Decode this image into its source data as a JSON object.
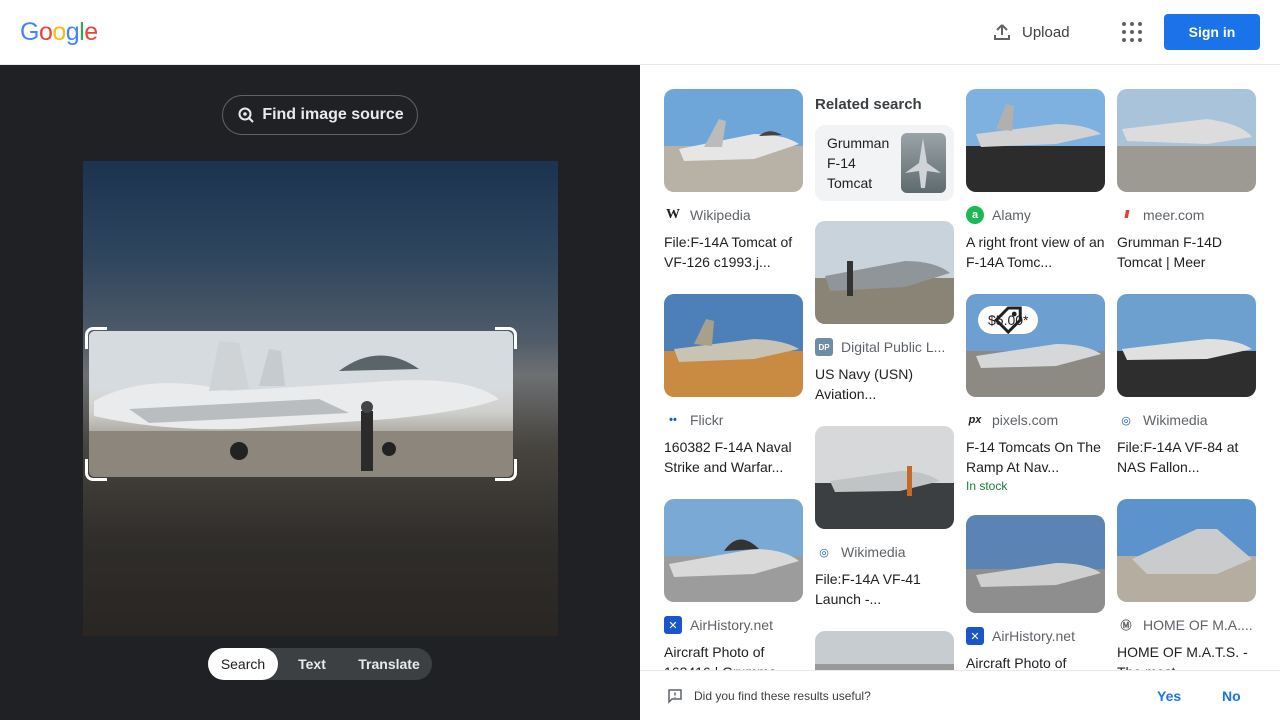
{
  "header": {
    "logo": [
      "G",
      "o",
      "o",
      "g",
      "l",
      "e"
    ],
    "logo_colors": [
      "#4285f4",
      "#ea4335",
      "#fbbc05",
      "#4285f4",
      "#34a853",
      "#ea4335"
    ],
    "upload_label": "Upload",
    "apps_icon": "apps-grid-icon",
    "signin_label": "Sign in"
  },
  "lens": {
    "find_source_label": "Find image source",
    "modes": [
      "Search",
      "Text",
      "Translate"
    ],
    "active_mode": "Search"
  },
  "results": {
    "related_heading": "Related search",
    "related_query": "Grumman F-14 Tomcat",
    "col1": [
      {
        "source": "Wikipedia",
        "favicon": "W",
        "favicon_color": "#fff",
        "favicon_text": "#202124",
        "title": "File:F-14A Tomcat of VF-126 c1993.j..."
      },
      {
        "source": "Flickr",
        "favicon": "••",
        "favicon_color": "#fff",
        "favicon_text": "#0063dc",
        "title": "160382 F-14A Naval Strike and Warfar..."
      },
      {
        "source": "AirHistory.net",
        "favicon": "✕",
        "favicon_color": "#1a56c8",
        "favicon_text": "#fff",
        "title": "Aircraft Photo of 163416 | Grumma..."
      }
    ],
    "col2": [
      {
        "source": "Digital Public L...",
        "favicon": "DP",
        "favicon_color": "#6e8ca6",
        "favicon_text": "#fff",
        "title": "US Navy (USN) Aviation..."
      },
      {
        "source": "Wikimedia",
        "favicon": "◎",
        "favicon_color": "#fff",
        "favicon_text": "#1a56c8",
        "title": "File:F-14A VF-41 Launch -..."
      }
    ],
    "col3": [
      {
        "source": "Alamy",
        "favicon": "a",
        "favicon_color": "#1db954",
        "favicon_text": "#fff",
        "title": "A right front view of an F-14A Tomc..."
      },
      {
        "source": "pixels.com",
        "favicon": "px",
        "favicon_color": "#fff",
        "favicon_text": "#202124",
        "title": "F-14 Tomcats On The Ramp At Nav...",
        "price": "$5.00*",
        "stock": "In stock"
      },
      {
        "source": "AirHistory.net",
        "favicon": "✕",
        "favicon_color": "#1a56c8",
        "favicon_text": "#fff",
        "title": "Aircraft Photo of"
      }
    ],
    "col4": [
      {
        "source": "meer.com",
        "favicon": "///",
        "favicon_color": "#fff",
        "favicon_text": "#e53935",
        "title": "Grumman F-14D Tomcat | Meer"
      },
      {
        "source": "Wikimedia",
        "favicon": "◎",
        "favicon_color": "#fff",
        "favicon_text": "#1a56c8",
        "title": "File:F-14A VF-84 at NAS Fallon..."
      },
      {
        "source": "HOME OF M.A....",
        "favicon": "Ⓜ",
        "favicon_color": "#fff",
        "favicon_text": "#5f6368",
        "title": "HOME OF M.A.T.S. - The most..."
      }
    ]
  },
  "feedback": {
    "question": "Did you find these results useful?",
    "yes": "Yes",
    "no": "No"
  }
}
